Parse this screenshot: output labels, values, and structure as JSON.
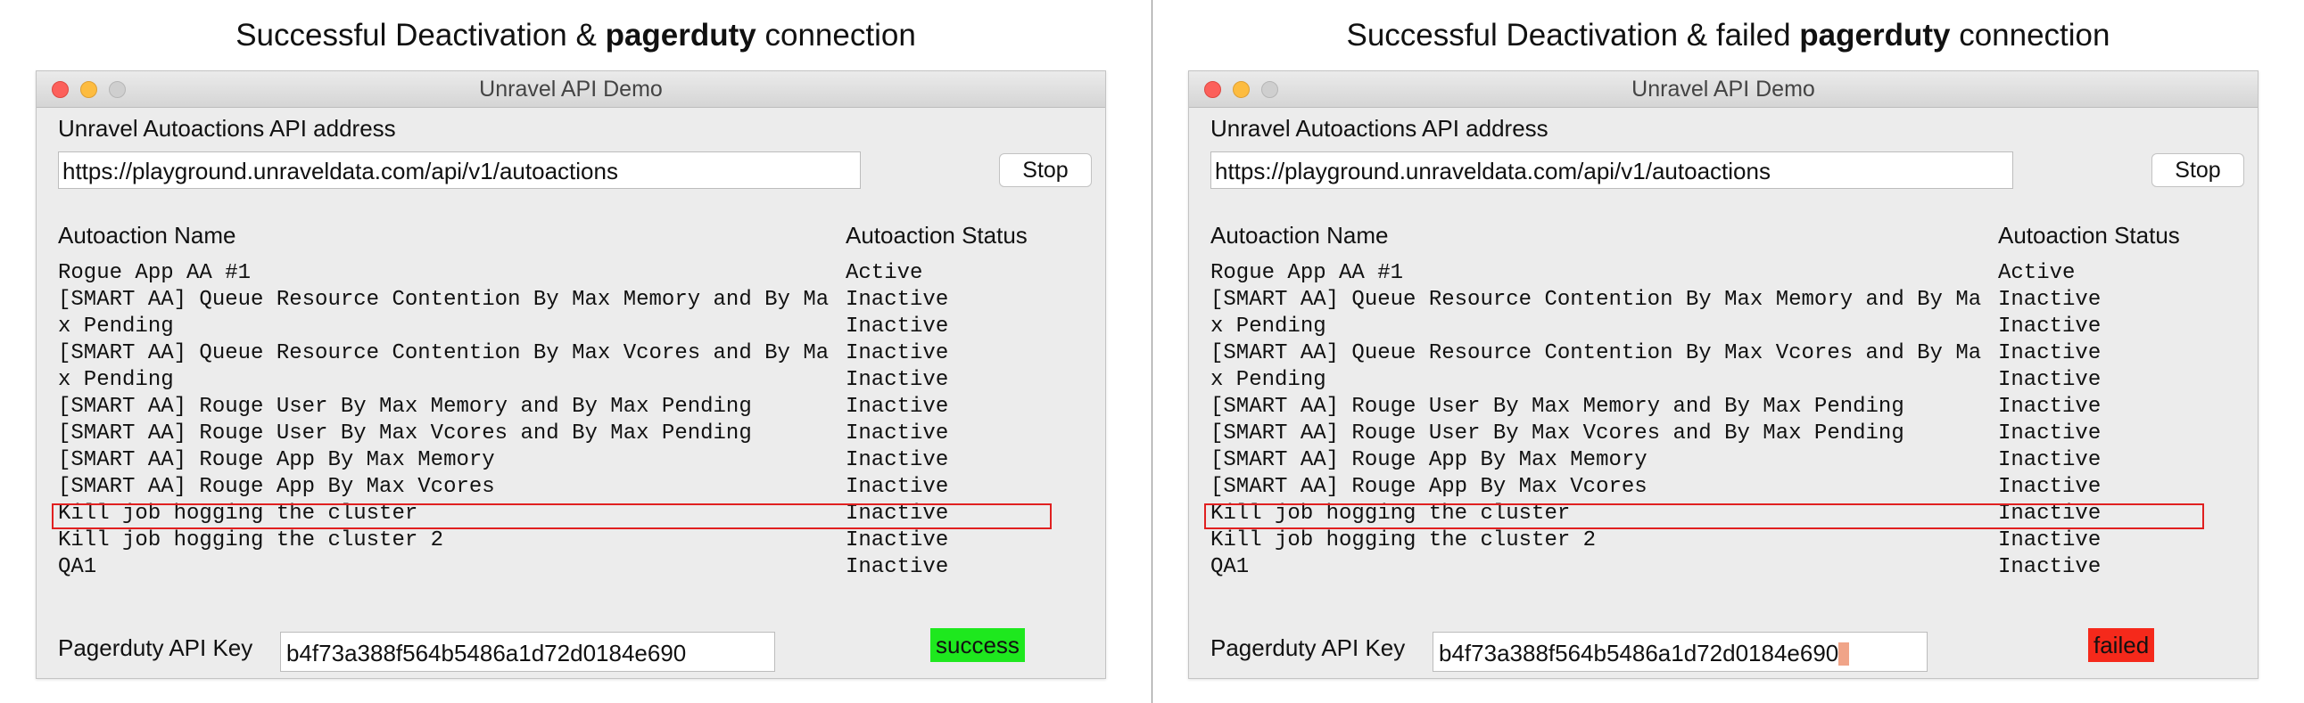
{
  "left": {
    "caption_prefix": "Successful Deactivation & ",
    "caption_bold": "pagerduty",
    "caption_suffix": " connection",
    "window_title": "Unravel API Demo",
    "address_label": "Unravel Autoactions API address",
    "address_value": "https://playground.unraveldata.com/api/v1/autoactions",
    "stop_label": "Stop",
    "col_name": "Autoaction Name",
    "col_status": "Autoaction Status",
    "pagerduty_label": "Pagerduty API Key",
    "pagerduty_key": "b4f73a388f564b5486a1d72d0184e690",
    "status_badge": "success",
    "status_color": "#1ee81e"
  },
  "right": {
    "caption_prefix": "Successful Deactivation & failed ",
    "caption_bold": "pagerduty",
    "caption_suffix": " connection",
    "window_title": "Unravel API Demo",
    "address_label": "Unravel Autoactions API address",
    "address_value": "https://playground.unraveldata.com/api/v1/autoactions",
    "stop_label": "Stop",
    "col_name": "Autoaction Name",
    "col_status": "Autoaction Status",
    "pagerduty_label": "Pagerduty API Key",
    "pagerduty_key": "b4f73a388f564b5486a1d72d0184e690",
    "status_badge": "failed",
    "status_color": "#f5291b"
  },
  "names": [
    "Rogue App AA #1",
    "[SMART AA] Queue Resource Contention By Max Memory and By Ma",
    "x Pending",
    "[SMART AA] Queue Resource Contention By Max Vcores and By Ma",
    "x Pending",
    "[SMART AA] Rouge User By Max Memory and By Max Pending",
    "[SMART AA] Rouge User By Max Vcores and By Max Pending",
    "[SMART AA] Rouge App By Max Memory",
    "[SMART AA] Rouge App By Max Vcores",
    "Kill job hogging the cluster",
    "Kill job hogging the cluster 2",
    "QA1"
  ],
  "statuses": [
    "Active",
    "Inactive",
    "Inactive",
    "Inactive",
    "Inactive",
    "Inactive",
    "Inactive",
    "Inactive",
    "Inactive",
    "Inactive",
    "Inactive",
    "Inactive"
  ]
}
